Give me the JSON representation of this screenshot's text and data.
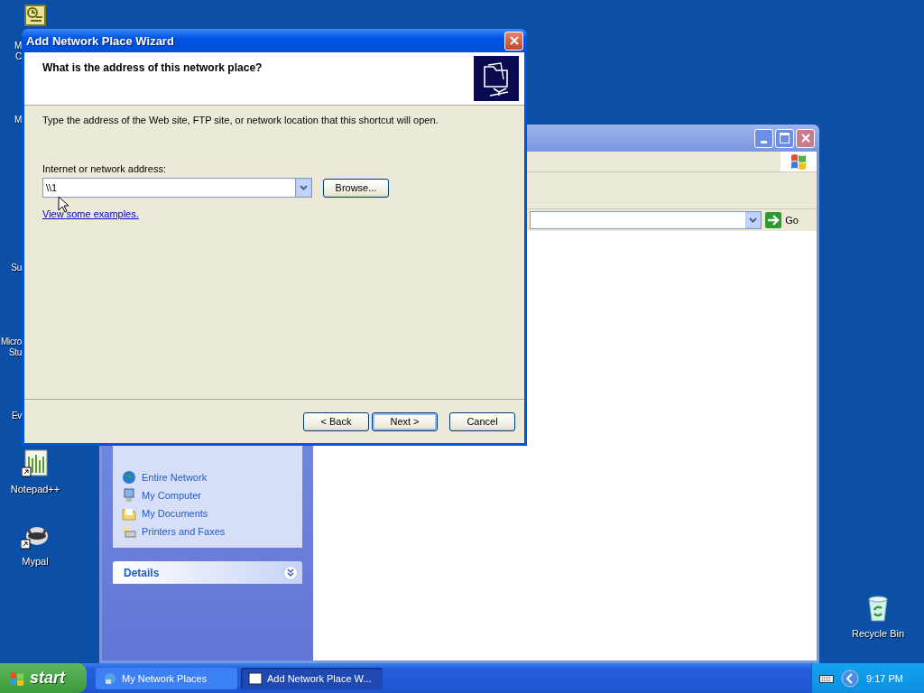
{
  "desktop": {
    "cut_labels": [
      {
        "label": "M"
      },
      {
        "label": "C"
      },
      {
        "label": "M"
      },
      {
        "label": "Su"
      },
      {
        "label": "Micro"
      },
      {
        "label": "Stu"
      },
      {
        "label": "Ev"
      }
    ],
    "icons": [
      {
        "label": "Notepad++"
      },
      {
        "label": "Mypal"
      },
      {
        "label": "Recycle Bin"
      }
    ]
  },
  "explorer_window": {
    "go_label": "Go",
    "other_places": [
      {
        "label": "Entire Network"
      },
      {
        "label": "My Computer"
      },
      {
        "label": "My Documents"
      },
      {
        "label": "Printers and Faxes"
      }
    ],
    "details_title": "Details"
  },
  "wizard": {
    "title": "Add Network Place Wizard",
    "heading": "What is the address of this network place?",
    "instruction": "Type the address of the Web site, FTP site, or network location that this shortcut will open.",
    "address_label": "Internet or network address:",
    "address_value": "\\\\1",
    "browse": "Browse...",
    "examples_link": "View some examples.",
    "buttons": [
      {
        "label": "< Back",
        "default": false
      },
      {
        "label": "Next >",
        "default": true
      },
      {
        "label": "Cancel",
        "default": false
      }
    ]
  },
  "taskbar": {
    "start": "start",
    "tasks": [
      {
        "label": "My Network Places",
        "selected": false
      },
      {
        "label": "Add Network Place W...",
        "selected": true
      }
    ],
    "clock": "9:17 PM"
  }
}
